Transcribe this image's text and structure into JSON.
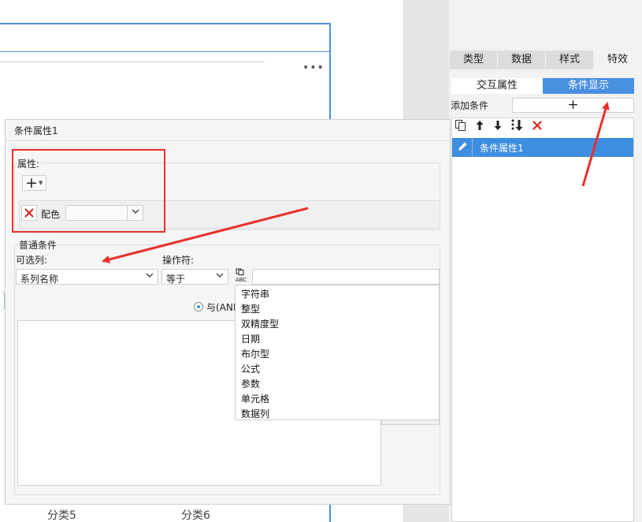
{
  "canvas": {
    "more_label": "•••",
    "x_categories": [
      "分类5",
      "分类6"
    ]
  },
  "right_panel": {
    "tabs": [
      {
        "label": "类型",
        "active": false
      },
      {
        "label": "数据",
        "active": false
      },
      {
        "label": "样式",
        "active": false
      },
      {
        "label": "特效",
        "active": true
      }
    ],
    "sub_tabs": [
      {
        "label": "交互属性",
        "active": false
      },
      {
        "label": "条件显示",
        "active": true
      }
    ],
    "add_condition_label": "添加条件",
    "add_condition_button": "+",
    "toolbar_icons": [
      "copy-icon",
      "arrow-up-icon",
      "arrow-down-icon",
      "move-bottom-icon",
      "delete-icon"
    ],
    "condition_items": [
      {
        "label": "条件属性1",
        "selected": true
      }
    ]
  },
  "dialog": {
    "title": "条件属性1",
    "property_section_label": "属性:",
    "add_property_button": "+",
    "color_row": {
      "label": "配色",
      "value": ""
    },
    "condition_section_label": "普通条件",
    "column_label": "可选列:",
    "operator_label": "操作符:",
    "column_value": "系列名称",
    "operator_value": "等于",
    "type_button_label": "ABC",
    "value_input": "",
    "and_label": "与(AND)",
    "type_options": [
      "字符串",
      "整型",
      "双精度型",
      "日期",
      "布尔型",
      "公式",
      "参数",
      "单元格",
      "数据列"
    ]
  },
  "colors": {
    "accent": "#4a90e2",
    "selected_item": "#3d8ee0",
    "annotation": "#e8302a"
  }
}
